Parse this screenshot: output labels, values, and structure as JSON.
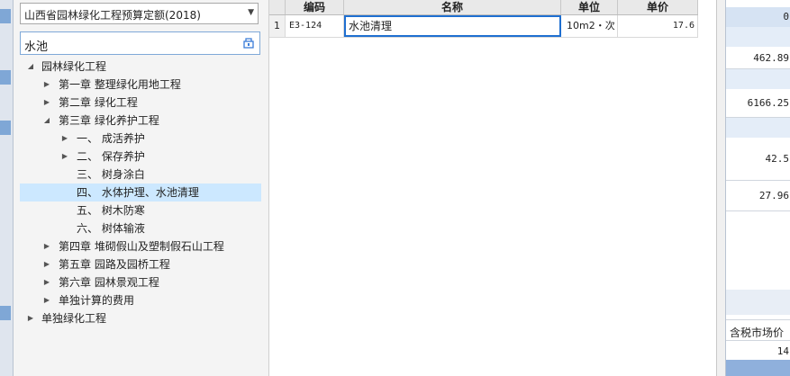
{
  "library_select": {
    "value": "山西省园林绿化工程预算定额(2018)"
  },
  "search": {
    "value": "水池"
  },
  "tree": {
    "nodes": [
      {
        "label": "园林绿化工程",
        "expanded": true
      },
      {
        "label": "第一章 整理绿化用地工程",
        "expanded": false
      },
      {
        "label": "第二章 绿化工程",
        "expanded": false
      },
      {
        "label": "第三章 绿化养护工程",
        "expanded": true
      },
      {
        "label": "一、 成活养护",
        "expanded": false
      },
      {
        "label": "二、 保存养护",
        "expanded": false
      },
      {
        "label": "三、 树身涂白",
        "expanded": null
      },
      {
        "label": "四、 水体护理、水池清理",
        "expanded": null,
        "selected": true
      },
      {
        "label": "五、 树木防寒",
        "expanded": null
      },
      {
        "label": "六、 树体输液",
        "expanded": null
      },
      {
        "label": "第四章 堆砌假山及塑制假石山工程",
        "expanded": false
      },
      {
        "label": "第五章 园路及园桥工程",
        "expanded": false
      },
      {
        "label": "第六章 园林景观工程",
        "expanded": false
      },
      {
        "label": "单独计算的费用",
        "expanded": false
      },
      {
        "label": "单独绿化工程",
        "expanded": false
      }
    ]
  },
  "table": {
    "headers": {
      "code": "编码",
      "name": "名称",
      "unit": "单位",
      "price": "单价"
    },
    "rows": [
      {
        "index": "1",
        "code": "E3-124",
        "name": "水池清理",
        "unit": "10m2・次",
        "price": "17.6"
      }
    ]
  },
  "right_panel": {
    "values": [
      "462.89",
      "6166.25",
      "42.5",
      "27.96"
    ],
    "header_label": "含税市场价",
    "partial_top": "0",
    "partial_bottom": "14"
  },
  "colors": {
    "selection": "#cce8ff",
    "edit_border": "#1f6fd0",
    "band": "#d6e3f3"
  }
}
